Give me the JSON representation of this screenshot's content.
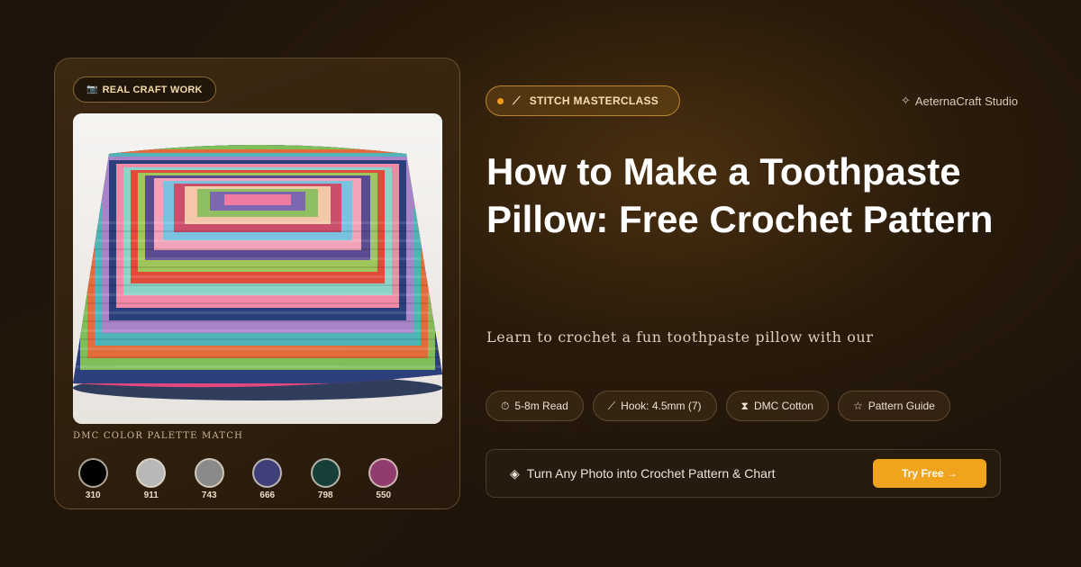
{
  "left_card": {
    "badge": {
      "icon": "camera-icon",
      "glyph": "📷",
      "label": "REAL CRAFT WORK"
    },
    "photo": {
      "subject": "crochet granny square pillow"
    },
    "palette_title": "DMC COLOR PALETTE MATCH",
    "swatches": [
      {
        "code": "310",
        "color": "#000000"
      },
      {
        "code": "911",
        "color": "#b8b8b8"
      },
      {
        "code": "743",
        "color": "#8a8a8a"
      },
      {
        "code": "666",
        "color": "#3f3f7a"
      },
      {
        "code": "798",
        "color": "#163f3a"
      },
      {
        "code": "550",
        "color": "#913b6e"
      }
    ]
  },
  "header": {
    "category_pill": {
      "icon": "magic-wand-icon",
      "glyph": "⟋",
      "label": "STITCH MASTERCLASS"
    },
    "brand": {
      "icon": "sparkle-icon",
      "glyph": "✧",
      "label": "AeternaCraft Studio"
    }
  },
  "article": {
    "title": "How to Make a Toothpaste Pillow: Free Crochet Pattern",
    "description": "Learn to crochet a fun toothpaste pillow with our"
  },
  "chips": [
    {
      "icon": "stopwatch-icon",
      "glyph": "⏱",
      "label": "5-8m Read"
    },
    {
      "icon": "hook-icon",
      "glyph": "⟋",
      "label": "Hook: 4.5mm (7)"
    },
    {
      "icon": "thread-spool-icon",
      "glyph": "⧗",
      "label": "DMC Cotton"
    },
    {
      "icon": "star-icon",
      "glyph": "☆",
      "label": "Pattern Guide"
    }
  ],
  "cta": {
    "icon": "shield-icon",
    "glyph": "◈",
    "text": "Turn Any Photo into Crochet Pattern & Chart",
    "button_label": "Try Free →"
  },
  "colors": {
    "accent": "#f0a31c",
    "background": "#1e140a"
  }
}
